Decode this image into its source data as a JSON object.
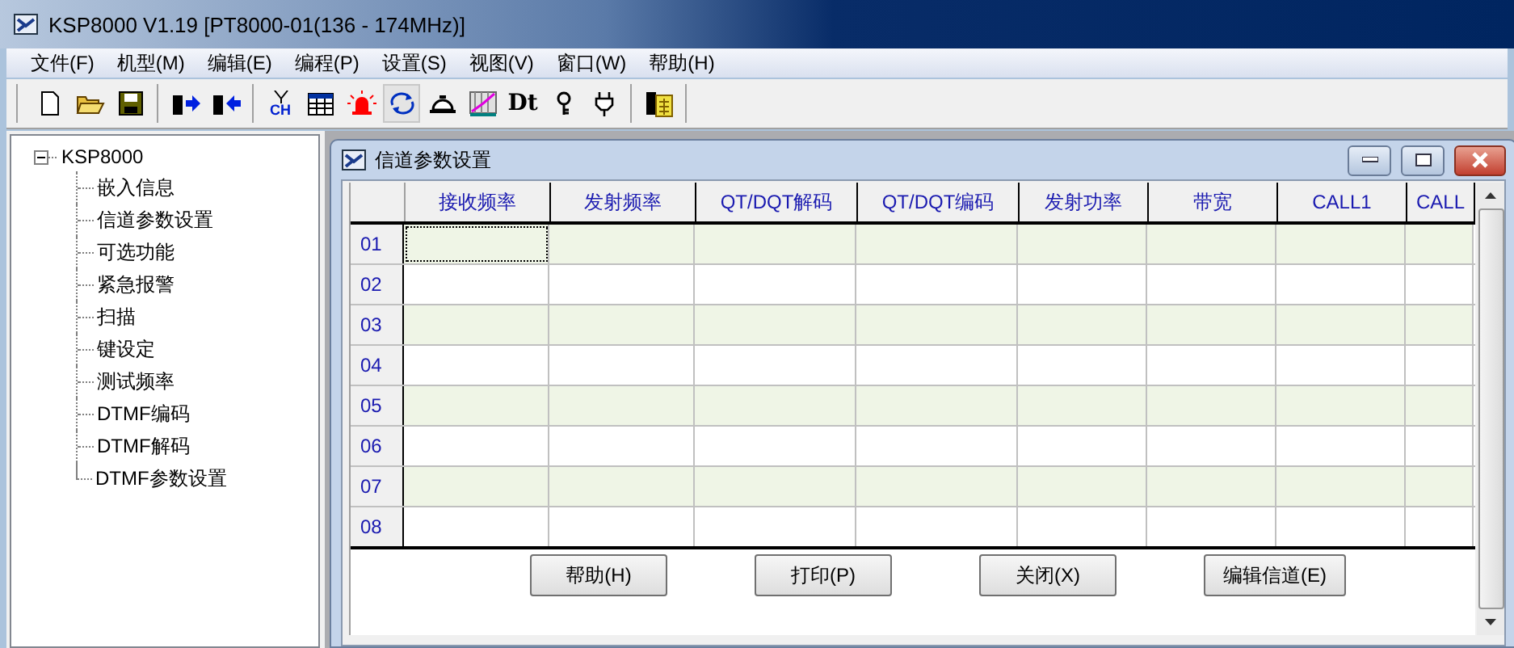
{
  "window": {
    "title": "KSP8000 V1.19  [PT8000-01(136 - 174MHz)]"
  },
  "menu": [
    "文件(F)",
    "机型(M)",
    "编辑(E)",
    "编程(P)",
    "设置(S)",
    "视图(V)",
    "窗口(W)",
    "帮助(H)"
  ],
  "toolbar": [
    {
      "kind": "new",
      "selected": false
    },
    {
      "kind": "open",
      "selected": false
    },
    {
      "kind": "save",
      "selected": false
    },
    {
      "kind": "sep"
    },
    {
      "kind": "write",
      "selected": false
    },
    {
      "kind": "read",
      "selected": false
    },
    {
      "kind": "sep"
    },
    {
      "kind": "antenna",
      "text": "CH",
      "selected": false
    },
    {
      "kind": "table",
      "selected": false
    },
    {
      "kind": "alarm",
      "selected": false
    },
    {
      "kind": "refresh",
      "selected": true
    },
    {
      "kind": "bell",
      "selected": false
    },
    {
      "kind": "graph",
      "selected": false
    },
    {
      "kind": "letters",
      "text": "Dt",
      "selected": false
    },
    {
      "kind": "key",
      "selected": false
    },
    {
      "kind": "plug",
      "selected": false
    },
    {
      "kind": "sep"
    },
    {
      "kind": "device",
      "selected": false
    },
    {
      "kind": "sep"
    }
  ],
  "tree": {
    "label": "KSP8000",
    "expanded": true,
    "children": [
      {
        "label": "嵌入信息"
      },
      {
        "label": "信道参数设置"
      },
      {
        "label": "可选功能"
      },
      {
        "label": "紧急报警"
      },
      {
        "label": "扫描"
      },
      {
        "label": "键设定"
      },
      {
        "label": "测试频率"
      },
      {
        "label": "DTMF编码"
      },
      {
        "label": "DTMF解码"
      },
      {
        "label": "DTMF参数设置"
      }
    ]
  },
  "child_window": {
    "title": "信道参数设置",
    "table": {
      "columns": [
        "接收频率",
        "发射频率",
        "QT/DQT解码",
        "QT/DQT编码",
        "发射功率",
        "带宽",
        "CALL1",
        "CALL"
      ],
      "rows": [
        {
          "label": "01",
          "selected": true
        },
        {
          "label": "02",
          "selected": false
        },
        {
          "label": "03",
          "selected": false
        },
        {
          "label": "04",
          "selected": false
        },
        {
          "label": "05",
          "selected": false
        },
        {
          "label": "06",
          "selected": false
        },
        {
          "label": "07",
          "selected": false
        },
        {
          "label": "08",
          "selected": false
        }
      ]
    },
    "buttons": [
      "帮助(H)",
      "打印(P)",
      "关闭(X)",
      "编辑信道(E)"
    ]
  }
}
